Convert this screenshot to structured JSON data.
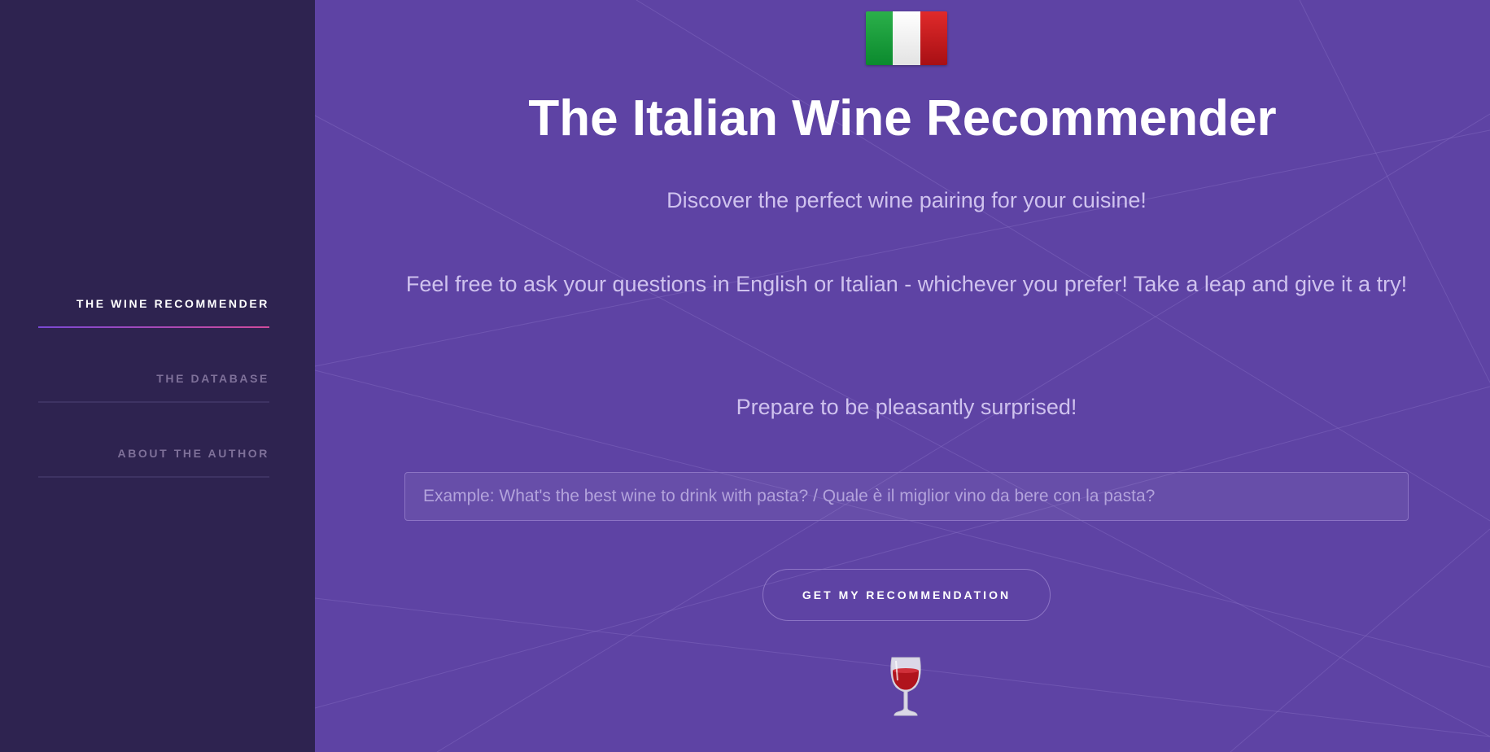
{
  "sidebar": {
    "items": [
      {
        "label": "THE WINE RECOMMENDER",
        "active": true
      },
      {
        "label": "THE DATABASE",
        "active": false
      },
      {
        "label": "ABOUT THE AUTHOR",
        "active": false
      }
    ]
  },
  "main": {
    "flag_icon": "italy-flag-icon",
    "title": "The Italian Wine Recommender",
    "intro": "Discover the perfect wine pairing for your cuisine!",
    "languages": "Feel free to ask your questions in English or Italian - whichever you prefer! Take a leap and give it a try!",
    "surprise": "Prepare to be pleasantly surprised!",
    "query": {
      "value": "",
      "placeholder": "Example: What's the best wine to drink with pasta? / Quale è il miglior vino da bere con la pasta?"
    },
    "submit_label": "GET MY RECOMMENDATION",
    "wine_icon": "wine-glass-icon"
  },
  "colors": {
    "sidebar_bg": "#2e2350",
    "main_bg": "#5e43a4",
    "accent_gradient_start": "#7a48d4",
    "accent_gradient_end": "#d04a9c",
    "muted_text": "#cfc2ee"
  }
}
